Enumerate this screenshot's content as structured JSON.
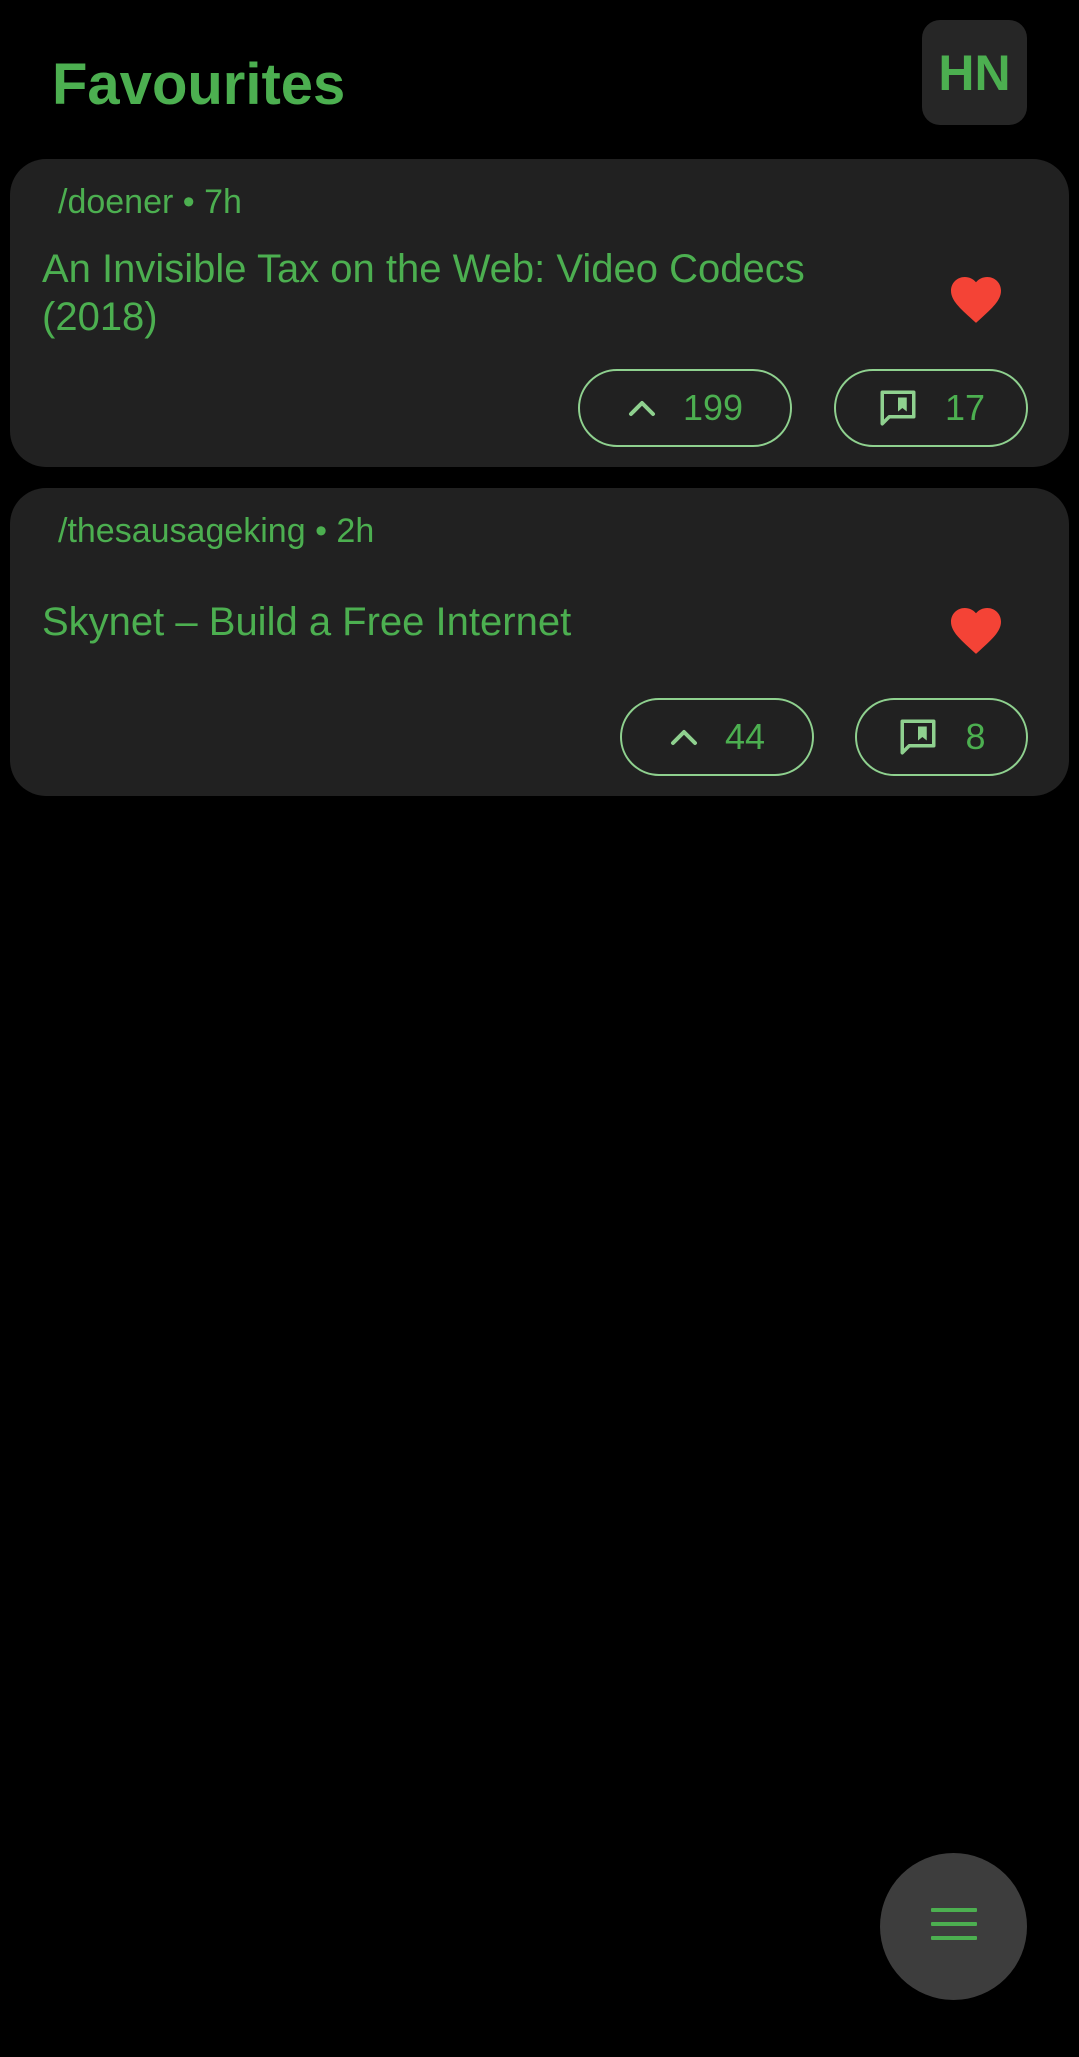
{
  "header": {
    "title": "Favourites",
    "logo_text": "HN"
  },
  "stories": [
    {
      "meta": "/doener • 7h",
      "title": "An Invisible Tax on the Web: Video Codecs (2018)",
      "favourite": true,
      "upvotes": "199",
      "comments": "17"
    },
    {
      "meta": "/thesausageking • 2h",
      "title": "Skynet – Build a Free Internet",
      "favourite": true,
      "upvotes": "44",
      "comments": "8"
    }
  ],
  "icons": {
    "favourite": "heart-icon",
    "upvote": "chevron-up-icon",
    "comments": "comment-icon",
    "menu": "menu-icon"
  },
  "colors": {
    "background": "#000000",
    "card": "#212121",
    "accent": "#4caf50",
    "pill_border": "#8fd18f",
    "heart": "#f44336",
    "fab": "#3d3d3d"
  }
}
